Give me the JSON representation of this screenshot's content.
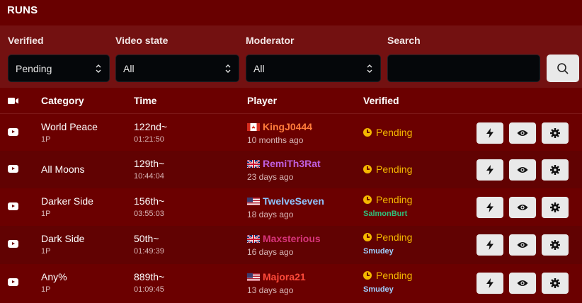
{
  "header": {
    "title": "RUNS"
  },
  "filters": {
    "verified_label": "Verified",
    "verified_value": "Pending",
    "video_label": "Video state",
    "video_value": "All",
    "moderator_label": "Moderator",
    "moderator_value": "All",
    "search_label": "Search",
    "search_value": ""
  },
  "table": {
    "columns": {
      "video": "video-icon",
      "category": "Category",
      "time": "Time",
      "player": "Player",
      "verified": "Verified"
    },
    "rows": [
      {
        "category": "World Peace",
        "sub": "1P",
        "rank": "122nd~",
        "time": "01:21:50",
        "flag": "ca",
        "player": "KingJ0444",
        "player_color": "#ff7a3a",
        "ago": "10 months ago",
        "status": "Pending",
        "verifier": "",
        "verifier_color": ""
      },
      {
        "category": "All Moons",
        "sub": "",
        "rank": "129th~",
        "time": "10:44:04",
        "flag": "gb",
        "player": "RemiTh3Rat",
        "player_color": "#c060e0",
        "ago": "23 days ago",
        "status": "Pending",
        "verifier": "",
        "verifier_color": ""
      },
      {
        "category": "Darker Side",
        "sub": "1P",
        "rank": "156th~",
        "time": "03:55:03",
        "flag": "us",
        "player": "TwelveSeven",
        "player_color": "#8fc4ff",
        "ago": "18 days ago",
        "status": "Pending",
        "verifier": "SalmonBurt",
        "verifier_color": "#2fbf7a"
      },
      {
        "category": "Dark Side",
        "sub": "1P",
        "rank": "50th~",
        "time": "01:49:39",
        "flag": "gb",
        "player": "Maxsterious",
        "player_color": "#d8347a",
        "ago": "16 days ago",
        "status": "Pending",
        "verifier": "Smudey",
        "verifier_color": "#9fd0ff"
      },
      {
        "category": "Any%",
        "sub": "1P",
        "rank": "889th~",
        "time": "01:09:45",
        "flag": "us",
        "player": "Majora21",
        "player_color": "#ff4a3a",
        "ago": "13 days ago",
        "status": "Pending",
        "verifier": "Smudey",
        "verifier_color": "#9fd0ff"
      }
    ]
  },
  "colors": {
    "background": "#6b0000",
    "pending": "#f5b800",
    "button": "#e9e9e9"
  },
  "icons": {
    "action1": "lightning-icon",
    "action2": "eye-icon",
    "action3": "gear-icon",
    "search": "search-icon"
  }
}
